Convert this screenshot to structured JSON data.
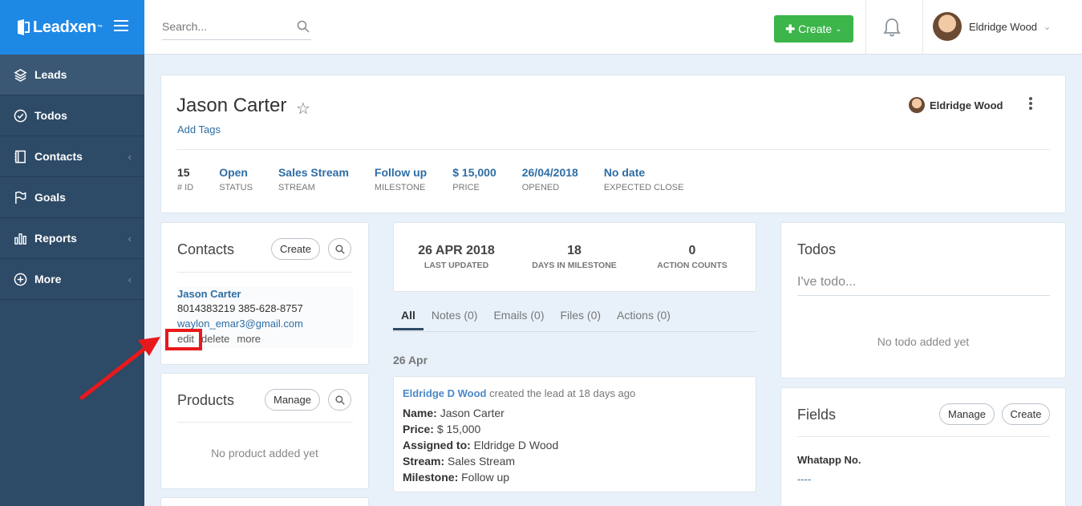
{
  "brand": {
    "name": "Leadxen",
    "tm": "™"
  },
  "sidebar": {
    "items": [
      {
        "label": "Leads",
        "icon": "layers-icon",
        "active": true,
        "chevron": false
      },
      {
        "label": "Todos",
        "icon": "check-circle-icon",
        "active": false,
        "chevron": false
      },
      {
        "label": "Contacts",
        "icon": "contacts-book-icon",
        "active": false,
        "chevron": true
      },
      {
        "label": "Goals",
        "icon": "flag-icon",
        "active": false,
        "chevron": false
      },
      {
        "label": "Reports",
        "icon": "bar-chart-icon",
        "active": false,
        "chevron": true
      },
      {
        "label": "More",
        "icon": "plus-circle-icon",
        "active": false,
        "chevron": true
      }
    ]
  },
  "header": {
    "search_placeholder": "Search...",
    "create_label": "Create",
    "user_name": "Eldridge Wood"
  },
  "lead": {
    "name": "Jason Carter",
    "add_tags": "Add Tags",
    "owner": "Eldridge Wood",
    "stats": [
      {
        "value": "15",
        "label": "# ID"
      },
      {
        "value": "Open",
        "label": "STATUS"
      },
      {
        "value": "Sales Stream",
        "label": "STREAM"
      },
      {
        "value": "Follow up",
        "label": "MILESTONE"
      },
      {
        "value": "$ 15,000",
        "label": "PRICE"
      },
      {
        "value": "26/04/2018",
        "label": "OPENED"
      },
      {
        "value": "No date",
        "label": "EXPECTED CLOSE"
      }
    ]
  },
  "contacts": {
    "title": "Contacts",
    "create_label": "Create",
    "contact": {
      "name": "Jason Carter",
      "phones": "8014383219 385-628-8757",
      "email": "waylon_emar3@gmail.com",
      "edit": "edit",
      "delete": "delete",
      "more": "more"
    }
  },
  "products": {
    "title": "Products",
    "manage_label": "Manage",
    "empty": "No product added yet"
  },
  "summary": {
    "last_updated": {
      "value": "26 APR 2018",
      "label": "LAST UPDATED"
    },
    "days_in_milestone": {
      "value": "18",
      "label": "DAYS IN MILESTONE"
    },
    "action_counts": {
      "value": "0",
      "label": "ACTION COUNTS"
    }
  },
  "tabs": [
    {
      "label": "All",
      "active": true
    },
    {
      "label": "Notes (0)",
      "active": false
    },
    {
      "label": "Emails (0)",
      "active": false
    },
    {
      "label": "Files (0)",
      "active": false
    },
    {
      "label": "Actions (0)",
      "active": false
    }
  ],
  "activity": {
    "date": "26 Apr",
    "actor": "Eldridge D Wood",
    "action": "created the lead at 18 days ago",
    "rows": [
      {
        "key": "Name:",
        "value": "Jason Carter"
      },
      {
        "key": "Price:",
        "value": "$ 15,000"
      },
      {
        "key": "Assigned to:",
        "value": "Eldridge D Wood"
      },
      {
        "key": "Stream:",
        "value": "Sales Stream"
      },
      {
        "key": "Milestone:",
        "value": "Follow up"
      }
    ]
  },
  "todos": {
    "title": "Todos",
    "placeholder": "I've todo...",
    "empty": "No todo added yet"
  },
  "fields": {
    "title": "Fields",
    "manage_label": "Manage",
    "create_label": "Create",
    "field_label": "Whatapp No.",
    "field_value": "----"
  },
  "colors": {
    "brand_blue": "#1e88e5",
    "sidebar": "#2d4a66",
    "create_green": "#3cb54a",
    "annotation_red": "#e8191c",
    "link": "#2e6da4"
  }
}
